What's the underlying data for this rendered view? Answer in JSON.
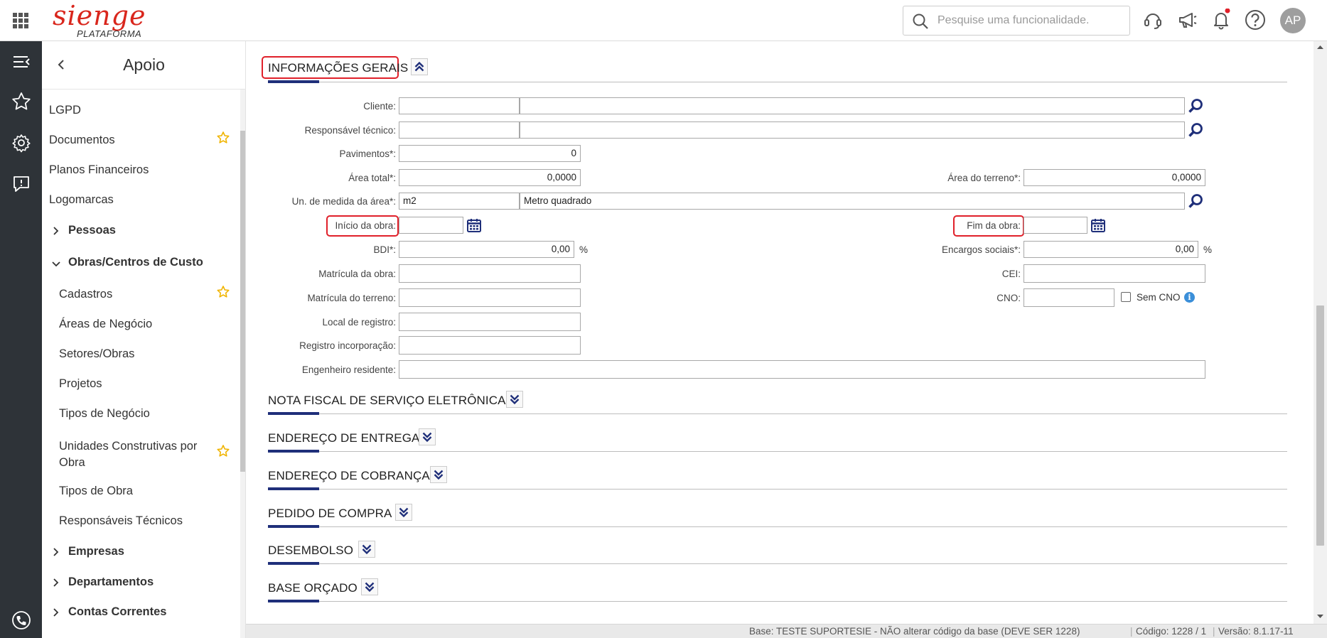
{
  "header": {
    "logo_main": "sienge",
    "logo_sub": "PLATAFORMA",
    "search_placeholder": "Pesquise uma funcionalidade.",
    "avatar_initials": "AP"
  },
  "sidemenu": {
    "title": "Apoio",
    "items": [
      {
        "label": "LGPD"
      },
      {
        "label": "Documentos"
      },
      {
        "label": "Planos Financeiros"
      },
      {
        "label": "Logomarcas"
      },
      {
        "label": "Pessoas"
      },
      {
        "label": "Obras/Centros de Custo"
      },
      {
        "label": "Cadastros"
      },
      {
        "label": "Áreas de Negócio"
      },
      {
        "label": "Setores/Obras"
      },
      {
        "label": "Projetos"
      },
      {
        "label": "Tipos de Negócio"
      },
      {
        "label": "Unidades Construtivas por Obra"
      },
      {
        "label": "Tipos de Obra"
      },
      {
        "label": "Responsáveis Técnicos"
      },
      {
        "label": "Empresas"
      },
      {
        "label": "Departamentos"
      },
      {
        "label": "Contas Correntes"
      }
    ]
  },
  "sections": {
    "info_gerais": "INFORMAÇÕES GERAIS",
    "nfse": "NOTA FISCAL DE SERVIÇO ELETRÔNICA",
    "end_entrega": "ENDEREÇO DE ENTREGA",
    "end_cobranca": "ENDEREÇO DE COBRANÇA",
    "pedido_compra": "PEDIDO DE COMPRA",
    "desembolso": "DESEMBOLSO",
    "base_orcado": "BASE ORÇADO"
  },
  "form": {
    "cliente": {
      "label": "Cliente:",
      "code": "",
      "name": ""
    },
    "responsavel": {
      "label": "Responsável técnico:",
      "code": "",
      "name": ""
    },
    "pavimentos": {
      "label": "Pavimentos*:",
      "value": "0"
    },
    "area_total": {
      "label": "Área total*:",
      "value": "0,0000"
    },
    "area_terreno": {
      "label": "Área do terreno*:",
      "value": "0,0000"
    },
    "un_medida": {
      "label": "Un. de medida da área*:",
      "code": "m2",
      "name": "Metro quadrado"
    },
    "inicio_obra": {
      "label": "Início da obra:",
      "value": ""
    },
    "fim_obra": {
      "label": "Fim da obra:",
      "value": ""
    },
    "bdi": {
      "label": "BDI*:",
      "value": "0,00",
      "unit": "%"
    },
    "encargos": {
      "label": "Encargos sociais*:",
      "value": "0,00",
      "unit": "%"
    },
    "matricula_obra": {
      "label": "Matrícula da obra:",
      "value": ""
    },
    "cei": {
      "label": "CEI:",
      "value": ""
    },
    "matricula_terreno": {
      "label": "Matrícula do terreno:",
      "value": ""
    },
    "cno": {
      "label": "CNO:",
      "value": "",
      "sem_cno_label": "Sem CNO"
    },
    "local_registro": {
      "label": "Local de registro:",
      "value": ""
    },
    "registro_incorporacao": {
      "label": "Registro incorporação:",
      "value": ""
    },
    "engenheiro": {
      "label": "Engenheiro residente:",
      "value": ""
    }
  },
  "footer": {
    "base": "Base: TESTE SUPORTESIE - NÃO alterar código da base (DEVE SER 1228)",
    "codigo": "Código: 1228 / 1",
    "versao": "Versão: 8.1.17-11"
  },
  "colors": {
    "brand_red": "#d9261c",
    "accent_navy": "#1f2f7a",
    "highlight_red": "#e0202a",
    "rail_dark": "#2e3338",
    "star_yellow": "#f0b400"
  }
}
